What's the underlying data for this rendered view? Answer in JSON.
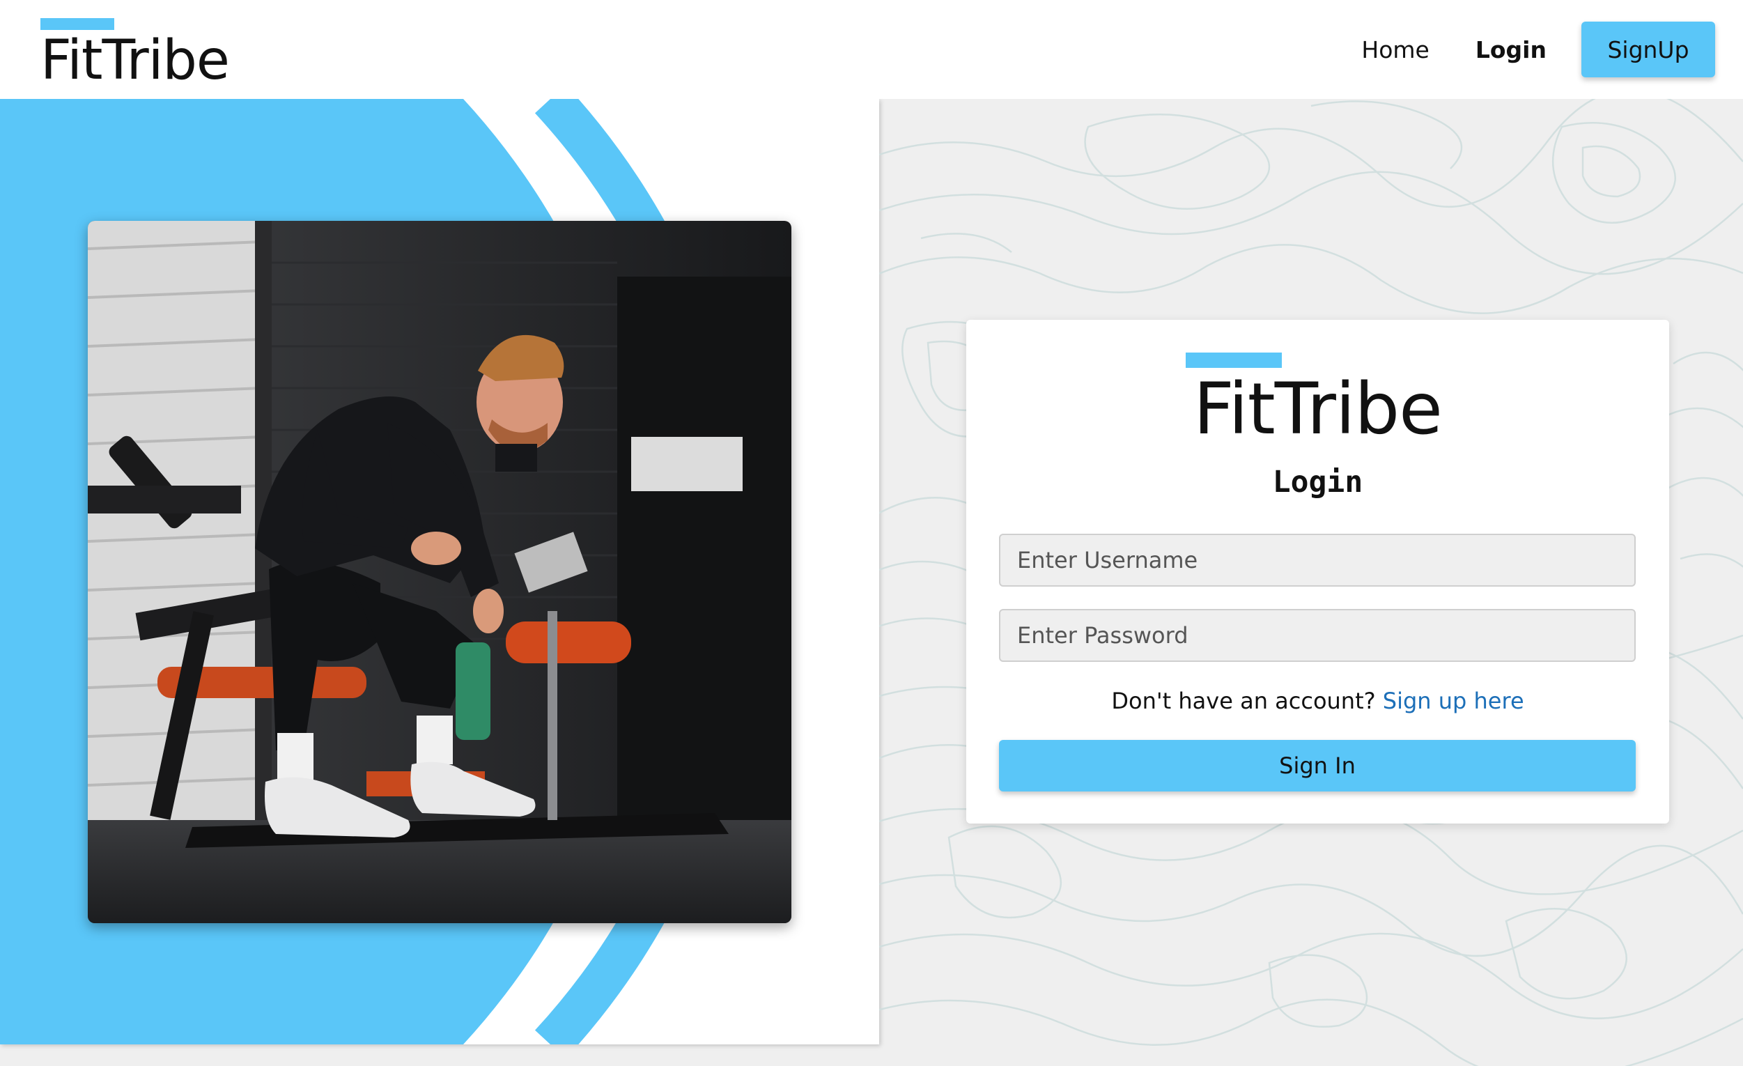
{
  "navbar": {
    "brand": "FitTribe",
    "links": {
      "home": "Home",
      "login": "Login",
      "signup": "SignUp"
    }
  },
  "hero": {
    "image_description": "man in black athletic wear sitting on a gym bench holding a green water bottle"
  },
  "login_card": {
    "brand": "FitTribe",
    "title": "Login",
    "username_placeholder": "Enter Username",
    "password_placeholder": "Enter Password",
    "signup_prompt": "Don't have an account?",
    "signup_link": "Sign up here",
    "submit_label": "Sign In"
  },
  "colors": {
    "accent": "#5ac6f8",
    "link": "#1c6fb8",
    "background": "#efefef"
  }
}
